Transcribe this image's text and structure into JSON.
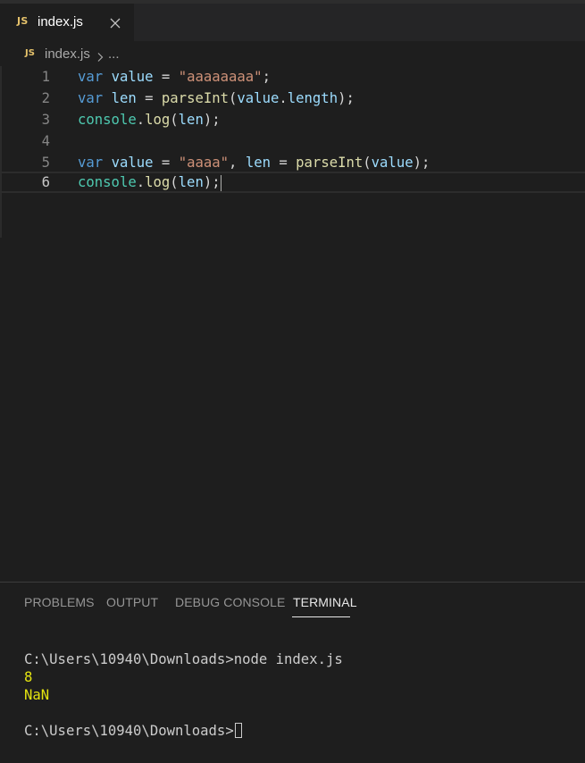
{
  "tab": {
    "badge": "JS",
    "label": "index.js"
  },
  "breadcrumb": {
    "badge": "JS",
    "file": "index.js",
    "more": "..."
  },
  "editor": {
    "lines": [
      {
        "number": "1",
        "tokens": [
          [
            "kw",
            "var"
          ],
          [
            "pn",
            " "
          ],
          [
            "var",
            "value"
          ],
          [
            "pn",
            " = "
          ],
          [
            "str",
            "\"aaaaaaaa\""
          ],
          [
            "pn",
            ";"
          ]
        ]
      },
      {
        "number": "2",
        "tokens": [
          [
            "kw",
            "var"
          ],
          [
            "pn",
            " "
          ],
          [
            "var",
            "len"
          ],
          [
            "pn",
            " = "
          ],
          [
            "fn",
            "parseInt"
          ],
          [
            "pn",
            "("
          ],
          [
            "var",
            "value"
          ],
          [
            "pn",
            "."
          ],
          [
            "var",
            "length"
          ],
          [
            "pn",
            ");"
          ]
        ]
      },
      {
        "number": "3",
        "tokens": [
          [
            "obj",
            "console"
          ],
          [
            "pn",
            "."
          ],
          [
            "fn",
            "log"
          ],
          [
            "pn",
            "("
          ],
          [
            "var",
            "len"
          ],
          [
            "pn",
            ");"
          ]
        ]
      },
      {
        "number": "4",
        "tokens": []
      },
      {
        "number": "5",
        "tokens": [
          [
            "kw",
            "var"
          ],
          [
            "pn",
            " "
          ],
          [
            "var",
            "value"
          ],
          [
            "pn",
            " = "
          ],
          [
            "str",
            "\"aaaa\""
          ],
          [
            "pn",
            ", "
          ],
          [
            "var",
            "len"
          ],
          [
            "pn",
            " = "
          ],
          [
            "fn",
            "parseInt"
          ],
          [
            "pn",
            "("
          ],
          [
            "var",
            "value"
          ],
          [
            "pn",
            ");"
          ]
        ]
      },
      {
        "number": "6",
        "tokens": [
          [
            "obj",
            "console"
          ],
          [
            "pn",
            "."
          ],
          [
            "fn",
            "log"
          ],
          [
            "pn",
            "("
          ],
          [
            "var",
            "len"
          ],
          [
            "pn",
            ");"
          ]
        ],
        "current": true
      }
    ]
  },
  "panel": {
    "tabs": [
      "PROBLEMS",
      "OUTPUT",
      "DEBUG CONSOLE",
      "TERMINAL"
    ],
    "active_tab": "TERMINAL"
  },
  "terminal": {
    "command_line": "C:\\Users\\10940\\Downloads>node index.js",
    "output_1": "8",
    "output_2": "NaN",
    "prompt": "C:\\Users\\10940\\Downloads>"
  },
  "colors": {
    "background": "#1e1e1e",
    "js_badge": "#e5c26b",
    "keyword": "#569cd6",
    "variable": "#9cdcfe",
    "string": "#ce9178",
    "function": "#dcdcaa",
    "object": "#4ec9b0",
    "terminal_output": "#e5e510"
  },
  "icons": [
    "close-icon",
    "chevron-right-icon",
    "js-file-icon"
  ]
}
